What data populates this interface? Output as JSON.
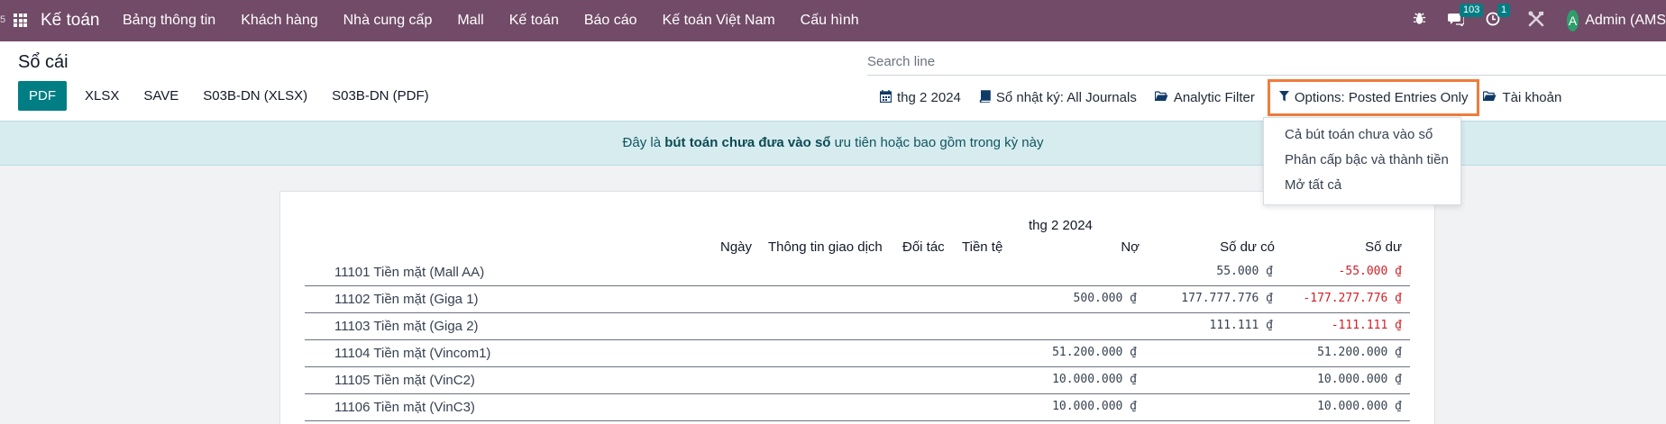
{
  "navbar": {
    "edge_char": "5",
    "app_name": "Kế toán",
    "menu": [
      "Bảng thông tin",
      "Khách hàng",
      "Nhà cung cấp",
      "Mall",
      "Kế toán",
      "Báo cáo",
      "Kế toán Việt Nam",
      "Cấu hình"
    ],
    "messages_count": "103",
    "activity_count": "1",
    "user_initial": "A",
    "user_name": "Admin (AMS"
  },
  "control_panel": {
    "title": "Sổ cái",
    "search_placeholder": "Search line",
    "buttons": [
      "PDF",
      "XLSX",
      "SAVE",
      "S03B-DN (XLSX)",
      "S03B-DN (PDF)"
    ],
    "filters": {
      "date": "thg 2 2024",
      "journals": "Sổ nhật ký: All Journals",
      "analytic": "Analytic Filter",
      "options": "Options: Posted Entries Only",
      "accounts": "Tài khoản"
    }
  },
  "alert": {
    "prefix": "Đây là ",
    "bold": "bút toán chưa đưa vào sổ",
    "suffix": " ưu tiên hoặc bao gồm trong kỳ này"
  },
  "dropdown": {
    "items": [
      "Cả bút toán chưa vào sổ",
      "Phân cấp bậc và thành tiền",
      "Mở tất cả"
    ]
  },
  "report": {
    "period": "thg 2 2024",
    "columns": {
      "date": "Ngày",
      "communication": "Thông tin giao dịch",
      "partner": "Đối tác",
      "currency": "Tiền tệ",
      "debit": "Nợ",
      "credit": "Số dư có",
      "balance": "Số dư"
    },
    "rows": [
      {
        "account": "11101 Tiền mặt (Mall AA)",
        "debit": "",
        "credit": "55.000 ₫",
        "balance": "-55.000 ₫"
      },
      {
        "account": "11102 Tiền mặt (Giga 1)",
        "debit": "500.000 ₫",
        "credit": "177.777.776 ₫",
        "balance": "-177.277.776 ₫"
      },
      {
        "account": "11103 Tiền mặt (Giga 2)",
        "debit": "",
        "credit": "111.111 ₫",
        "balance": "-111.111 ₫"
      },
      {
        "account": "11104 Tiền mặt (Vincom1)",
        "debit": "51.200.000 ₫",
        "credit": "",
        "balance": "51.200.000 ₫"
      },
      {
        "account": "11105 Tiền mặt (VinC2)",
        "debit": "10.000.000 ₫",
        "credit": "",
        "balance": "10.000.000 ₫"
      },
      {
        "account": "11106 Tiền mặt (VinC3)",
        "debit": "10.000.000 ₫",
        "credit": "",
        "balance": "10.000.000 ₫"
      }
    ]
  }
}
